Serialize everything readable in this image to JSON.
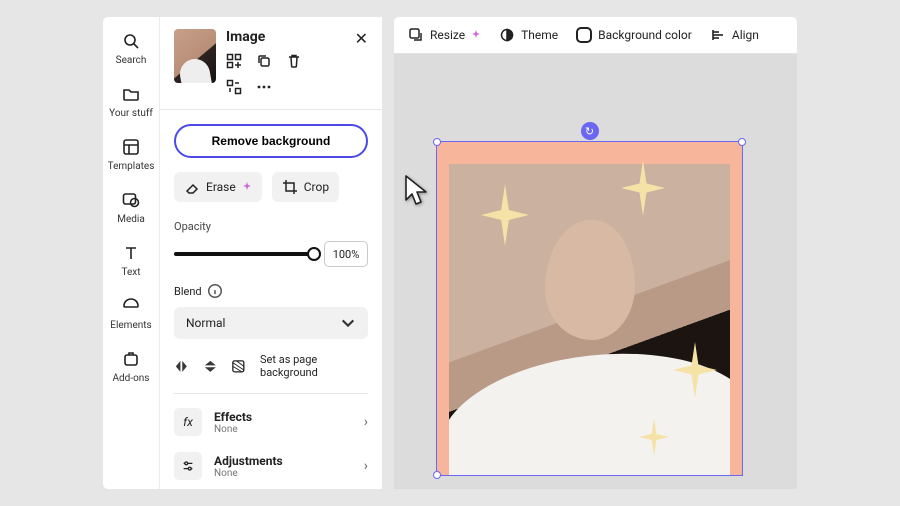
{
  "rail": {
    "items": [
      {
        "label": "Search"
      },
      {
        "label": "Your stuff"
      },
      {
        "label": "Templates"
      },
      {
        "label": "Media"
      },
      {
        "label": "Text"
      },
      {
        "label": "Elements"
      },
      {
        "label": "Add-ons"
      }
    ]
  },
  "topbar": {
    "resize": "Resize",
    "theme": "Theme",
    "bgcolor": "Background color",
    "align": "Align"
  },
  "panel": {
    "title": "Image",
    "remove_bg": "Remove background",
    "erase": "Erase",
    "crop": "Crop",
    "opacity_label": "Opacity",
    "opacity_value": "100%",
    "blend_label": "Blend",
    "blend_value": "Normal",
    "set_bg": "Set as page background",
    "effects": {
      "title": "Effects",
      "sub": "None"
    },
    "adjustments": {
      "title": "Adjustments",
      "sub": "None"
    }
  }
}
